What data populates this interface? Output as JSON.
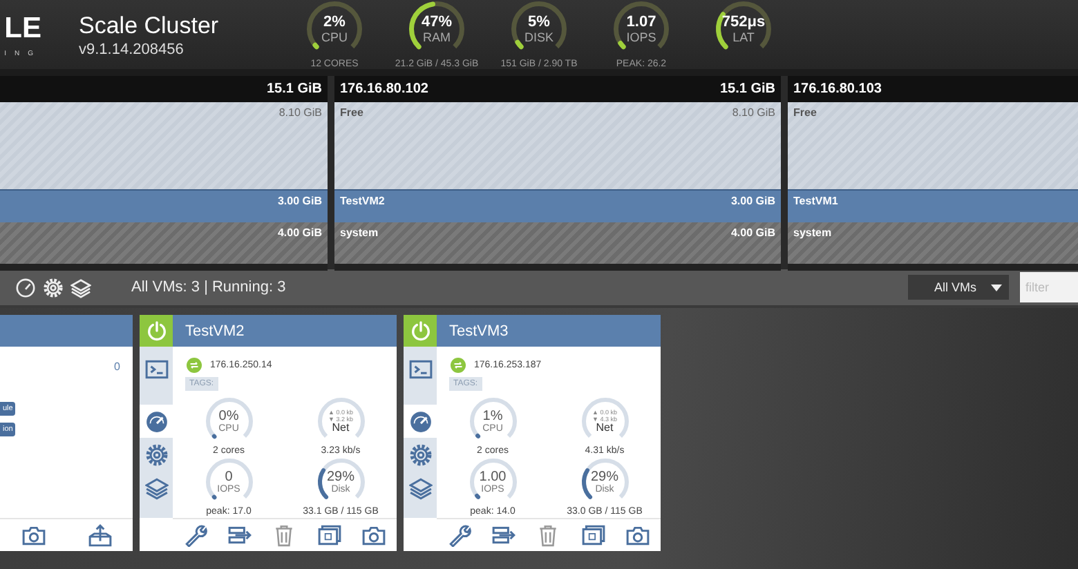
{
  "header": {
    "logo": {
      "mark": "LE",
      "tagline": "ING"
    },
    "title": "Scale Cluster",
    "version": "v9.1.14.208456",
    "gauges": [
      {
        "value": "2%",
        "label": "CPU",
        "level": 0.02,
        "detail": "12 CORES"
      },
      {
        "value": "47%",
        "label": "RAM",
        "level": 0.47,
        "detail": "21.2 GiB / 45.3 GiB"
      },
      {
        "value": "5%",
        "label": "DISK",
        "level": 0.05,
        "detail": "151 GiB / 2.90 TB"
      },
      {
        "value": "1.07",
        "label": "IOPS",
        "level": 0.04,
        "detail": "PEAK: 26.2"
      },
      {
        "value": "752μs",
        "label": "LAT",
        "level": 0.3
      }
    ]
  },
  "nodes": [
    {
      "total": "15.1 GiB",
      "segments": [
        {
          "kind": "free",
          "size": "8.10 GiB"
        },
        {
          "kind": "vm",
          "size": "3.00 GiB"
        },
        {
          "kind": "system",
          "size": "4.00 GiB"
        }
      ]
    },
    {
      "ip": "176.16.80.102",
      "total": "15.1 GiB",
      "segments": [
        {
          "kind": "free",
          "label": "Free",
          "size": "8.10 GiB"
        },
        {
          "kind": "vm",
          "label": "TestVM2",
          "size": "3.00 GiB"
        },
        {
          "kind": "system",
          "label": "system",
          "size": "4.00 GiB"
        }
      ]
    },
    {
      "ip": "176.16.80.103",
      "segments": [
        {
          "kind": "free",
          "label": "Free"
        },
        {
          "kind": "vm",
          "label": "TestVM1"
        },
        {
          "kind": "system",
          "label": "system"
        }
      ]
    }
  ],
  "toolbar": {
    "summary": "All VMs: 3 | Running: 3",
    "view_select": "All VMs",
    "filter": {
      "placeholder": "filter"
    }
  },
  "vms": [
    {
      "kind": "clipped",
      "count": "0",
      "tags": [
        "ule",
        "ion"
      ],
      "actions": [
        {
          "kind": "snapshot"
        },
        {
          "kind": "export"
        }
      ]
    },
    {
      "kind": "full",
      "name": "TestVM2",
      "running": true,
      "ip": "176.16.250.14",
      "tags_label": "TAGS:",
      "tabs": [
        {
          "kind": "console",
          "selected": false
        },
        {
          "kind": "stats",
          "selected": true
        },
        {
          "kind": "settings",
          "selected": false
        },
        {
          "kind": "disks",
          "selected": false
        }
      ],
      "stats": [
        {
          "kind": "cpu",
          "value": "0%",
          "label": "CPU",
          "level": 0,
          "detail": "2 cores"
        },
        {
          "kind": "net",
          "up": "▲ 0.0 kb",
          "down": "▼ 3.2 kb",
          "label": "Net",
          "detail": "3.23 kb/s"
        },
        {
          "kind": "iops",
          "value": "0",
          "label": "IOPS",
          "level": 0,
          "detail": "peak: 17.0"
        },
        {
          "kind": "disk",
          "value": "29%",
          "label": "Disk",
          "level": 0.29,
          "detail": "33.1 GB / 115 GB"
        }
      ],
      "actions": [
        {
          "kind": "edit"
        },
        {
          "kind": "move"
        },
        {
          "kind": "delete"
        },
        {
          "kind": "clone"
        },
        {
          "kind": "snapshot"
        }
      ]
    },
    {
      "kind": "full",
      "name": "TestVM3",
      "running": true,
      "ip": "176.16.253.187",
      "tags_label": "TAGS:",
      "tabs": [
        {
          "kind": "console",
          "selected": false
        },
        {
          "kind": "stats",
          "selected": true
        },
        {
          "kind": "settings",
          "selected": false
        },
        {
          "kind": "disks",
          "selected": false
        }
      ],
      "stats": [
        {
          "kind": "cpu",
          "value": "1%",
          "label": "CPU",
          "level": 0.01,
          "detail": "2 cores"
        },
        {
          "kind": "net",
          "up": "▲ 0.0 kb",
          "down": "▼ 4.3 kb",
          "label": "Net",
          "detail": "4.31 kb/s"
        },
        {
          "kind": "iops",
          "value": "1.00",
          "label": "IOPS",
          "level": 0.02,
          "detail": "peak: 14.0"
        },
        {
          "kind": "disk",
          "value": "29%",
          "label": "Disk",
          "level": 0.29,
          "detail": "33.0 GB / 115 GB"
        }
      ],
      "actions": [
        {
          "kind": "edit"
        },
        {
          "kind": "move"
        },
        {
          "kind": "delete"
        },
        {
          "kind": "clone"
        },
        {
          "kind": "snapshot"
        }
      ]
    }
  ]
}
